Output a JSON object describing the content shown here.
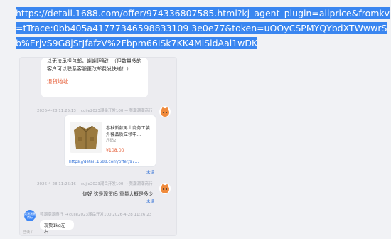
{
  "address_bar": {
    "url": "https://detail.1688.com/offer/974336807585.html?kj_agent_plugin=aliprice&fromkv=tTrace:0bb405a41777346598833109 3e0e77&token=uOOyCSPMYQYbdXTWwwrSb%ErjvS9G8jStJfafzV%2Fbpm66ISk7KK4MiSldAal1wDK"
  },
  "chat": {
    "notice": {
      "text": "以无法承担包邮，谢谢理解！（但数量多的客户可以联系客服更改邮费发快递！）",
      "link": "退货地址"
    },
    "msg1": {
      "time": "2026-4-28 11:25:13",
      "sender": "cujie2023潮岳开发100 → 莞潮潮潮商行"
    },
    "product": {
      "title": "春秋新款男士商务工装外套品质立领中...",
      "spec": "尺码2",
      "price": "¥108.00",
      "url": "https://detail.1688.com/offer/97...",
      "read": "未读"
    },
    "msg2": {
      "time": "2026-4-28 11:25:16",
      "sender": "cujie2023潮岳开发100 → 莞潮潮潮商行",
      "text": "你好 这是现货吗 重量大概是多少",
      "read": "未读"
    },
    "msg3": {
      "shop": "莞潮潮潮商行",
      "header": "莞潮潮潮商行 → cujie2023潮岳开发100  2026-4-28 11:26:23",
      "text": "现货1kg左右"
    },
    "bottom": "已读 /"
  },
  "colors": {
    "selection": "#3a86f0",
    "accent_red": "#e5572f",
    "link_blue": "#2f6fd6",
    "panel_bg": "#ececf0"
  }
}
